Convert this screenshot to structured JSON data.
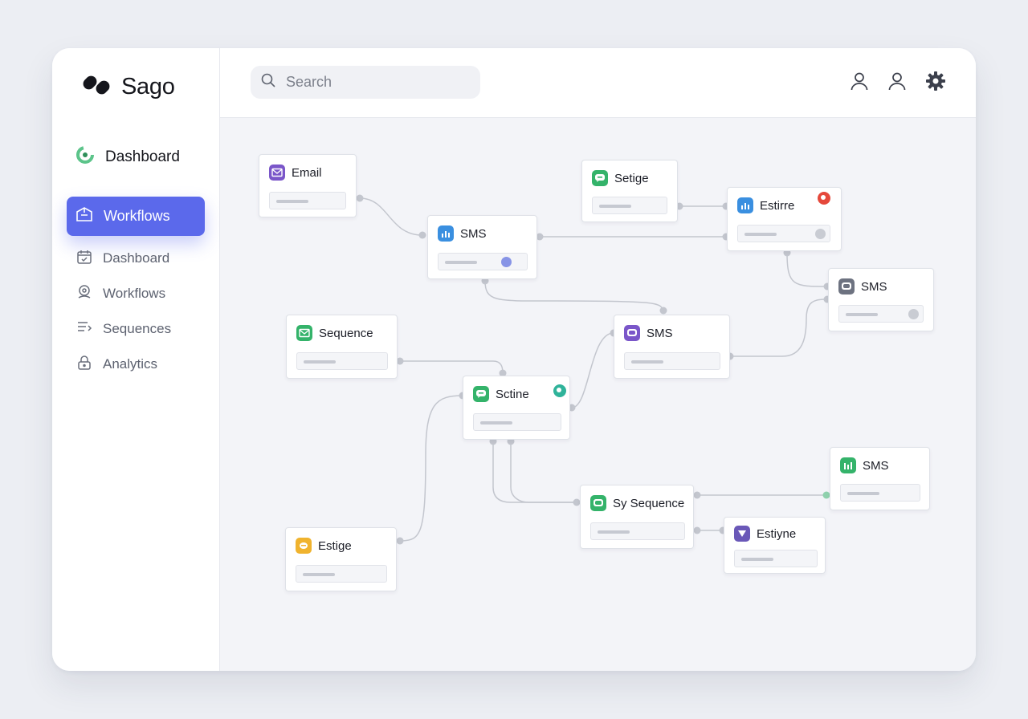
{
  "app": {
    "name": "Sago"
  },
  "sidebar": {
    "main_item": "Dashboard",
    "active_item": "Workflows",
    "items": [
      {
        "label": "Dashboard",
        "icon": "calendar-icon"
      },
      {
        "label": "Workflows",
        "icon": "location-pin-icon"
      },
      {
        "label": "Sequences",
        "icon": "list-lines-icon"
      },
      {
        "label": "Analytics",
        "icon": "lock-icon"
      }
    ]
  },
  "topbar": {
    "search_placeholder": "Search",
    "icons": [
      "user-icon",
      "user-icon",
      "gear-icon"
    ]
  },
  "nodes": [
    {
      "label": "Email",
      "icon": "mail-icon",
      "color": "#7a56c9"
    },
    {
      "label": "SMS",
      "icon": "bar-chart-icon",
      "color": "#3a8fe0"
    },
    {
      "label": "Setige",
      "icon": "chat-bubble-icon",
      "color": "#34b36a"
    },
    {
      "label": "Estirre",
      "icon": "bar-chart-icon",
      "color": "#3a8fe0",
      "status_color": "#e5483b"
    },
    {
      "label": "SMS",
      "icon": "chat-bubble-icon",
      "color": "#6d7280"
    },
    {
      "label": "Sequence",
      "icon": "mail-icon",
      "color": "#34b36a"
    },
    {
      "label": "SMS",
      "icon": "chat-bubble-icon",
      "color": "#7a56c9"
    },
    {
      "label": "Sctine",
      "icon": "chat-bubble-icon",
      "color": "#34b36a",
      "status_color": "#2fb39a"
    },
    {
      "label": "SMS",
      "icon": "bar-chart-icon",
      "color": "#34b36a"
    },
    {
      "label": "Sy Sequence",
      "icon": "chat-bubble-icon",
      "color": "#34b36a"
    },
    {
      "label": "Estiyne",
      "icon": "triangle-down-icon",
      "color": "#6a58b8"
    },
    {
      "label": "Estige",
      "icon": "coin-icon",
      "color": "#f0b32e"
    }
  ],
  "colors": {
    "accent": "#5b69eb",
    "dot_accent": "#8794e6"
  }
}
